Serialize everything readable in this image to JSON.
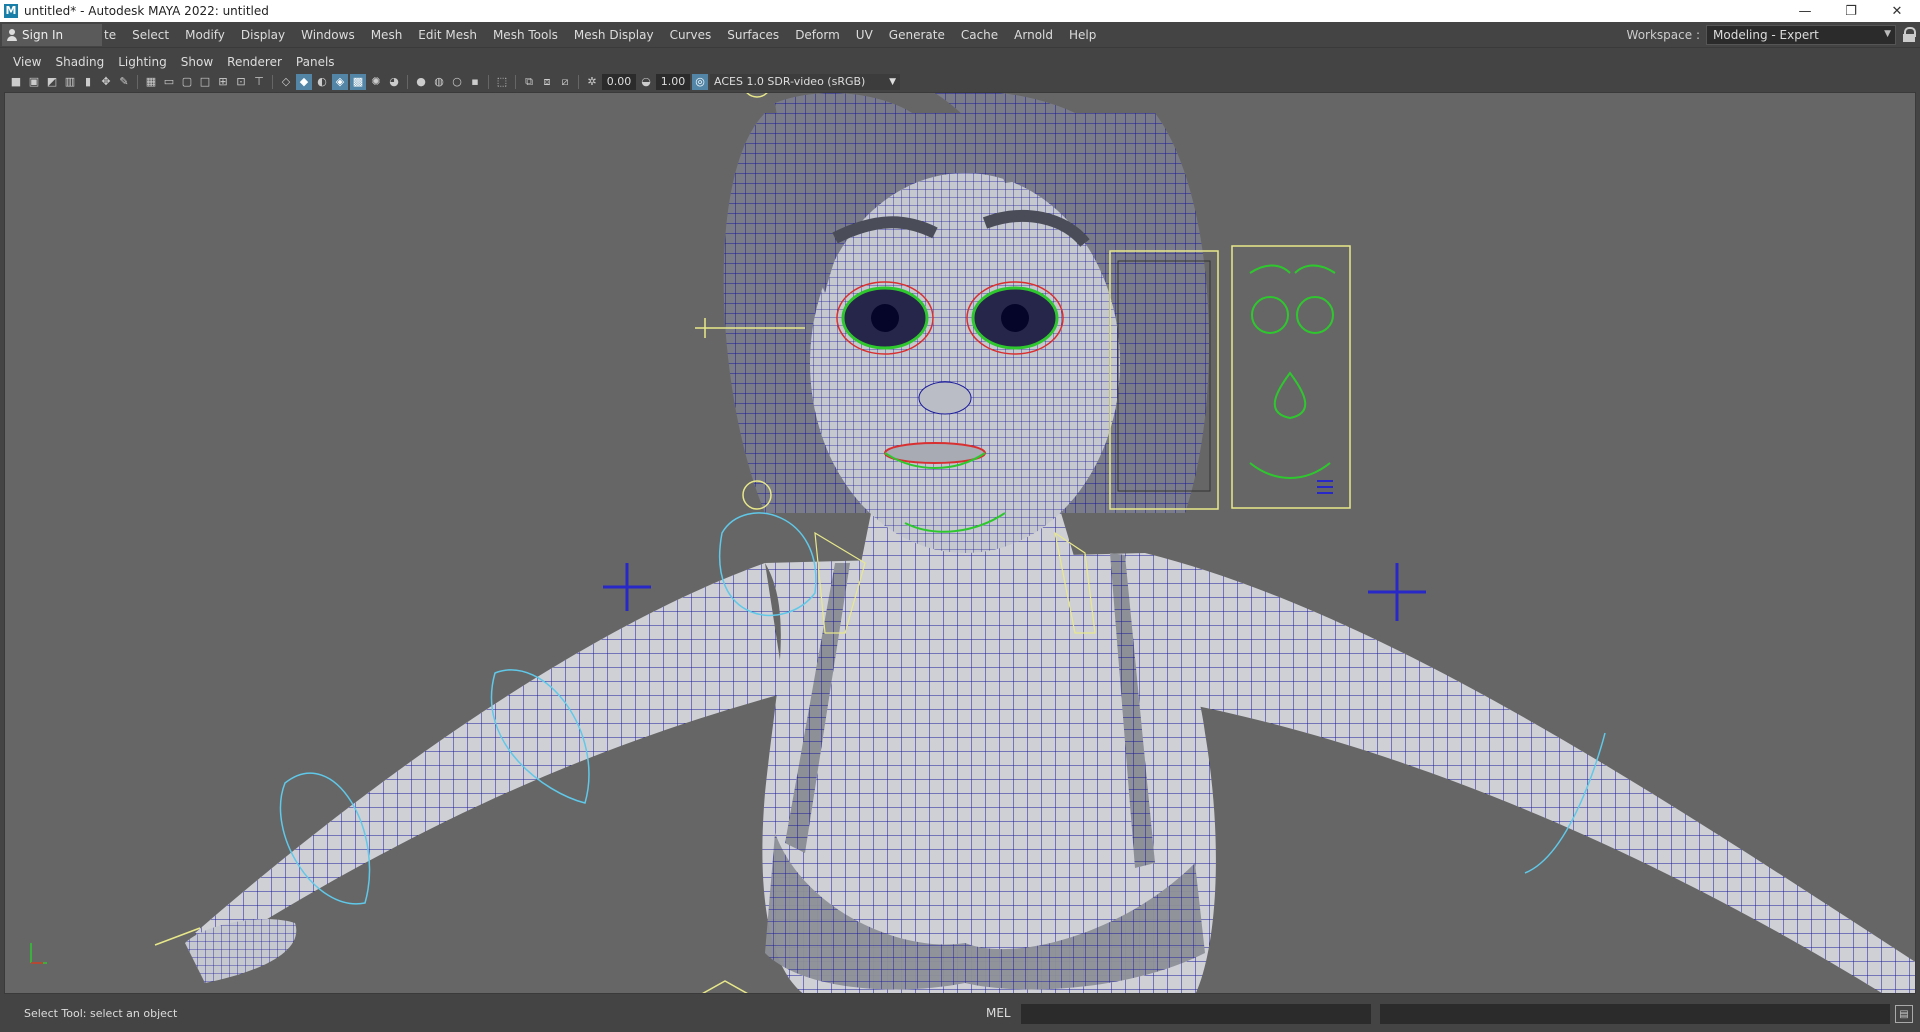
{
  "window": {
    "title": "untitled* - Autodesk MAYA 2022: untitled",
    "app_icon": "M",
    "minimize_glyph": "—",
    "maximize_glyph": "❐",
    "close_glyph": "✕"
  },
  "menubar": {
    "sign_in": "Sign In",
    "clipped_item": "te",
    "items": [
      "Select",
      "Modify",
      "Display",
      "Windows",
      "Mesh",
      "Edit Mesh",
      "Mesh Tools",
      "Mesh Display",
      "Curves",
      "Surfaces",
      "Deform",
      "UV",
      "Generate",
      "Cache",
      "Arnold",
      "Help"
    ],
    "workspace_label": "Workspace :",
    "workspace_value": "Modeling - Expert"
  },
  "panel_menu": {
    "items": [
      "View",
      "Shading",
      "Lighting",
      "Show",
      "Renderer",
      "Panels"
    ]
  },
  "panel_toolbar": {
    "exposure_value": "0.00",
    "gamma_value": "1.00",
    "color_space": "ACES 1.0 SDR-video (sRGB)"
  },
  "status": {
    "help_line": "Select Tool: select an object",
    "command_language": "MEL"
  },
  "colors": {
    "viewport_bg": "#666666",
    "wireframe": "#1a1a9a",
    "control_yellow": "#e8e88a",
    "control_cyan": "#60c8e8",
    "control_green": "#2ec82e",
    "control_red": "#d83030",
    "control_blue": "#2828c8"
  }
}
